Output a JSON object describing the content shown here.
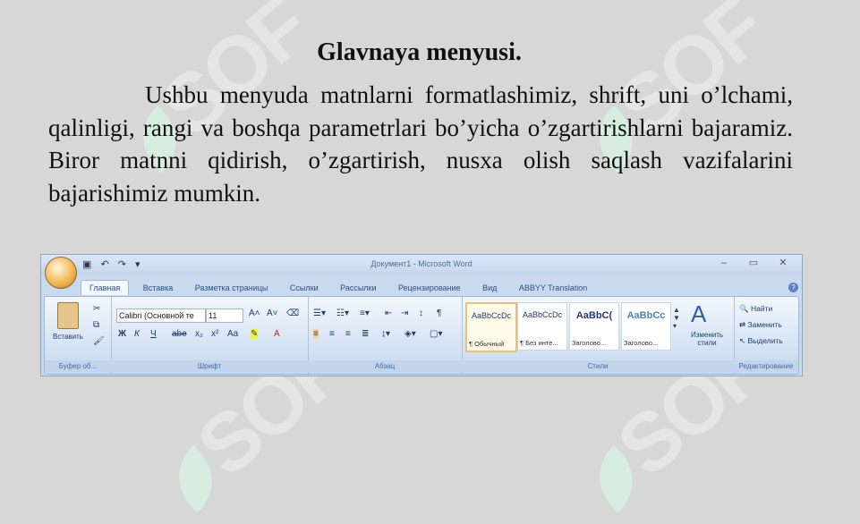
{
  "slide": {
    "title": "Glavnaya menyusi.",
    "paragraph": "Ushbu menyuda matnlarni formatlashimiz, shrift, uni o’lchami,  qalinligi, rangi va boshqa parametrlari bo’yicha o’zgartirishlarni bajaramiz. Biror matnni qidirish, o’zgartirish, nusxa olish saqlash vazifalarini bajarishimiz mumkin.",
    "watermark": "SOF"
  },
  "word": {
    "window_title": "Документ1 - Microsoft Word",
    "tabs": [
      "Главная",
      "Вставка",
      "Разметка страницы",
      "Ссылки",
      "Рассылки",
      "Рецензирование",
      "Вид",
      "ABBYY Translation"
    ],
    "clipboard": {
      "paste_label": "Вставить",
      "group_label": "Буфер об..."
    },
    "font": {
      "name": "Calibri (Основной те",
      "size": "11",
      "group_label": "Шрифт",
      "bold": "Ж",
      "italic": "К",
      "underline": "Ч",
      "strike": "abe",
      "subscript": "x₂",
      "superscript": "x²",
      "case": "Aa",
      "grow": "A˄",
      "shrink": "A˅"
    },
    "paragraph": {
      "group_label": "Абзац"
    },
    "styles": {
      "group_label": "Стили",
      "items": [
        {
          "sample": "AaBbCcDc",
          "name": "¶ Обычный"
        },
        {
          "sample": "AaBbCcDc",
          "name": "¶ Без инте..."
        },
        {
          "sample": "AaBbC(",
          "name": "Заголово..."
        },
        {
          "sample": "AaBbCc",
          "name": "Заголово..."
        }
      ],
      "change_label": "Изменить стили"
    },
    "editing": {
      "group_label": "Редактирование",
      "find": "Найти",
      "replace": "Заменить",
      "select": "Выделить"
    },
    "colors": {
      "accent": "#15428b",
      "ribbon": "#dbe7f6",
      "highlight": "#e8c27a"
    }
  }
}
